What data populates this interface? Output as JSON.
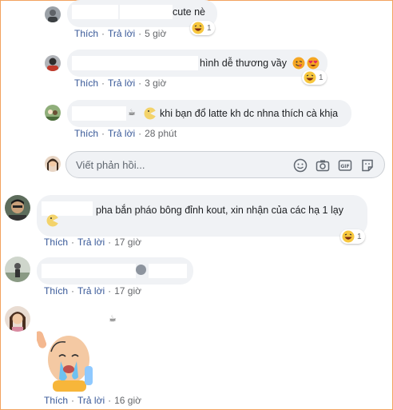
{
  "colors": {
    "bubble": "#f0f2f5",
    "link": "#385898",
    "meta": "#65676b",
    "frame": "#f3a35f"
  },
  "comments": [
    {
      "text": "cute nè",
      "actions": {
        "like": "Thích",
        "reply": "Trả lời",
        "time": "5 giờ"
      },
      "reaction_count": "1",
      "reaction_icon": "laughing-emoji"
    },
    {
      "text": "hình dễ thương vầy",
      "actions": {
        "like": "Thích",
        "reply": "Trả lời",
        "time": "3 giờ"
      },
      "reaction_count": "1",
      "reaction_icon": "laughing-emoji"
    },
    {
      "text": "khi bạn đổ latte kh dc nhna thích cà khịa",
      "actions": {
        "like": "Thích",
        "reply": "Trả lời",
        "time": "28 phút"
      }
    },
    {
      "text": "pha bắn pháo bông đỉnh kout, xin nhận của các hạ 1 lạy",
      "actions": {
        "like": "Thích",
        "reply": "Trả lời",
        "time": "17 giờ"
      },
      "reaction_count": "1",
      "reaction_icon": "laughing-emoji"
    },
    {
      "text": "",
      "actions": {
        "like": "Thích",
        "reply": "Trả lời",
        "time": "17 giờ"
      }
    },
    {
      "text": "",
      "actions": {
        "like": "Thích",
        "reply": "Trả lời",
        "time": "16 giờ"
      },
      "sticker": "crying-bald-man-sticker"
    }
  ],
  "reply_box": {
    "placeholder": "Viết phản hồi...",
    "icons": [
      "emoji-icon",
      "camera-icon",
      "gif-icon",
      "sticker-icon"
    ]
  }
}
